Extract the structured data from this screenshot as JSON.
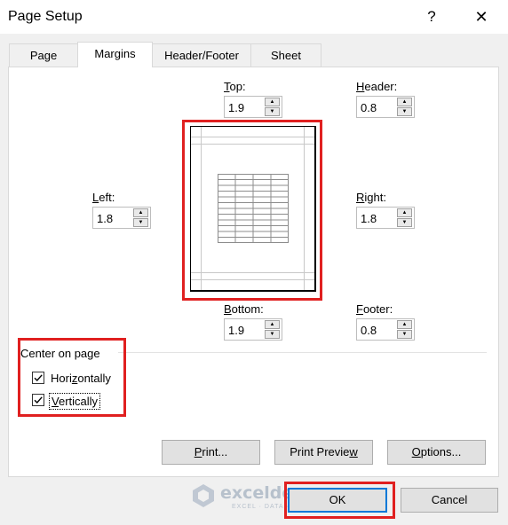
{
  "window": {
    "title": "Page Setup",
    "help_glyph": "?",
    "close_glyph": "✕"
  },
  "tabs": [
    {
      "label": "Page",
      "active": false
    },
    {
      "label": "Margins",
      "active": true
    },
    {
      "label": "Header/Footer",
      "active": false
    },
    {
      "label": "Sheet",
      "active": false
    }
  ],
  "margins": {
    "top": {
      "label_mnemonic": "T",
      "label_rest": "op:",
      "value": "1.9"
    },
    "header": {
      "label_mnemonic": "H",
      "label_rest": "eader:",
      "value": "0.8"
    },
    "left": {
      "label_mnemonic": "L",
      "label_rest": "eft:",
      "value": "1.8"
    },
    "right": {
      "label_mnemonic": "R",
      "label_rest": "ight:",
      "value": "1.8"
    },
    "bottom": {
      "label_mnemonic": "B",
      "label_rest": "ottom:",
      "value": "1.9"
    },
    "footer": {
      "label_mnemonic": "F",
      "label_rest": "ooter:",
      "value": "0.8"
    }
  },
  "center_on_page": {
    "heading": "Center on page",
    "horizontally": {
      "label_pre": "Hori",
      "label_mnemonic": "z",
      "label_post": "ontally",
      "checked": true
    },
    "vertically": {
      "label_mnemonic": "V",
      "label_post": "ertically",
      "checked": true
    }
  },
  "buttons": {
    "print": {
      "label_mnemonic": "P",
      "label_post": "rint..."
    },
    "print_preview": {
      "label_pre": "Print Previe",
      "label_mnemonic": "w",
      "label_post": ""
    },
    "options": {
      "label_mnemonic": "O",
      "label_post": "ptions..."
    },
    "ok": "OK",
    "cancel": "Cancel"
  },
  "watermark": {
    "name": "exceldemy",
    "tagline": "EXCEL · DATA · BI"
  },
  "colors": {
    "highlight": "#e02020",
    "focus": "#0078d7",
    "panel_bg": "#ffffff",
    "dialog_bg": "#f0f0f0"
  }
}
